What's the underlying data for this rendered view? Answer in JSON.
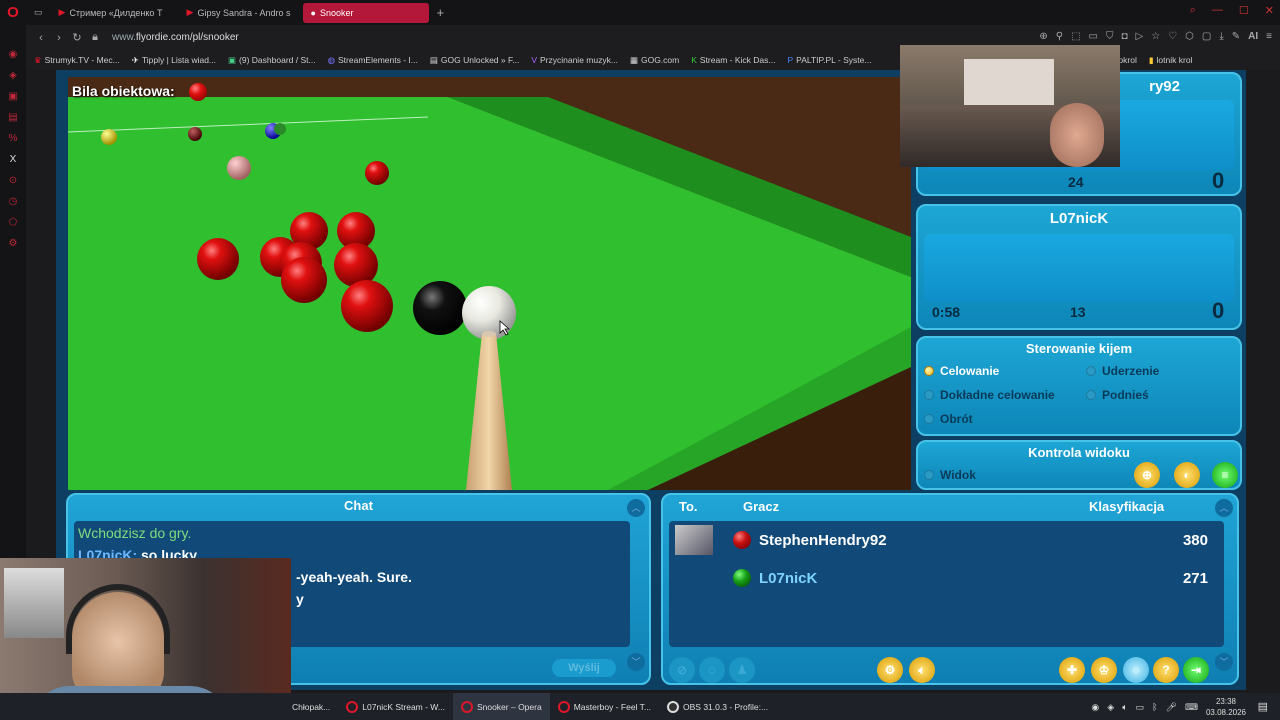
{
  "browser": {
    "tabs": [
      {
        "label": "Стример «Дилденко Т"
      },
      {
        "label": "Gipsy Sandra - Andro s"
      },
      {
        "label": "Snooker"
      }
    ],
    "url_prefix": "www.",
    "url_main": "flyordie.com/pl/snooker",
    "bookmarks": [
      "Strumyk.TV - Mec...",
      "Tipply | Lista wiad...",
      "(9) Dashboard / St...",
      "StreamElements - I...",
      "GOG Unlocked » F...",
      "Przycinanie muzyk...",
      "GOG.com",
      "Stream - Kick Das...",
      "PALTIP.PL - Syste...",
      "lotnik tokrol",
      "lotnik krol"
    ],
    "ai_label": "AI"
  },
  "game": {
    "object_ball_label": "Bila obiektowa:",
    "player1": {
      "name": "StephenHendry92",
      "name_partial": "ry92",
      "stat": "24",
      "score": "0"
    },
    "player2": {
      "name": "L07nicK",
      "time": "0:58",
      "stat": "13",
      "score": "0"
    },
    "cue_control": {
      "title": "Sterowanie kijem",
      "options": [
        "Celowanie",
        "Uderzenie",
        "Dokładne celowanie",
        "Podnieś",
        "Obrót"
      ],
      "selected": "Celowanie"
    },
    "view_control": {
      "title": "Kontrola widoku",
      "option": "Widok"
    },
    "chat": {
      "title": "Chat",
      "lines": [
        {
          "text": "Wchodzisz do gry.",
          "color": "#7fdc7f"
        },
        {
          "user": "L07nicK:",
          "text": "so lucky"
        },
        {
          "text": "-yeah-yeah. Sure."
        },
        {
          "text": "y"
        }
      ],
      "send_label": "Wyślij"
    },
    "players_table": {
      "col_to": "To.",
      "col_player": "Gracz",
      "col_rank": "Klasyfikacja",
      "rows": [
        {
          "name": "StephenHendry92",
          "rating": "380",
          "ball_color": "#c81010",
          "name_color": "#ffffff"
        },
        {
          "name": "L07nicK",
          "rating": "271",
          "ball_color": "#18a018",
          "name_color": "#7fd4ff"
        }
      ]
    }
  },
  "taskbar": {
    "tasks": [
      "Chłopak...",
      "L07nicK Stream - W...",
      "Snooker – Opera",
      "Masterboy - Feel T...",
      "OBS 31.0.3 - Profile:..."
    ],
    "time": "23:38",
    "date": "03.08.2026"
  },
  "colors": {
    "accent": "#b3173a",
    "table_green": "#2fbf2f",
    "panel_blue": "#1da6d4"
  }
}
